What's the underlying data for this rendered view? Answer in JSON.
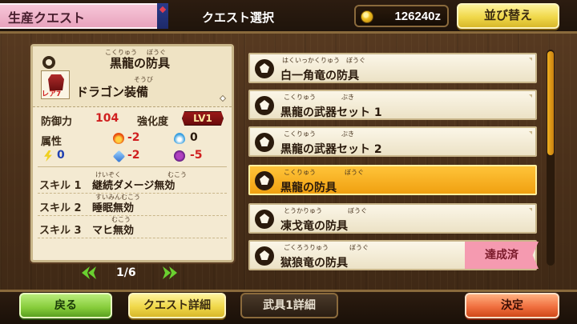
{
  "header": {
    "mode_tab": "生産クエスト",
    "screen_title": "クエスト選択",
    "money": "126240z",
    "sort_label": "並び替え"
  },
  "detail": {
    "name_ruby_1": "こくりゅう",
    "name_ruby_2": "ぼうぐ",
    "name": "黒龍の防具",
    "rarity": "レア7",
    "category_ruby": "そうび",
    "category": "ドラゴン装備",
    "defense_label": "防御力",
    "defense_value": "104",
    "enhance_label": "強化度",
    "level": "LV1",
    "attribute_label": "属性",
    "fire": "-2",
    "water": "0",
    "thunder": "0",
    "ice": "-2",
    "dragon": "-5",
    "skills": [
      {
        "slot": "スキル 1",
        "name": "継続ダメージ無効",
        "ruby_1": "けいぞく",
        "ruby_2": "むこう"
      },
      {
        "slot": "スキル 2",
        "name": "睡眠無効",
        "ruby_1": "すいみんむこう",
        "ruby_2": ""
      },
      {
        "slot": "スキル 3",
        "name": "マヒ無効",
        "ruby_1": "むこう",
        "ruby_2": ""
      }
    ]
  },
  "pager": {
    "text": "1/6"
  },
  "quests": [
    {
      "title": "白一角竜の防具",
      "ruby_1": "はくいっかくりゅう",
      "ruby_2": "ぼうぐ",
      "selected": false,
      "status": ""
    },
    {
      "title": "黒龍の武器セット 1",
      "ruby_1": "こくりゅう",
      "ruby_2": "ぶき",
      "selected": false,
      "status": ""
    },
    {
      "title": "黒龍の武器セット 2",
      "ruby_1": "こくりゅう",
      "ruby_2": "ぶき",
      "selected": false,
      "status": ""
    },
    {
      "title": "黒龍の防具",
      "ruby_1": "こくりゅう",
      "ruby_2": "ぼうぐ",
      "selected": true,
      "status": ""
    },
    {
      "title": "凍戈竜の防具",
      "ruby_1": "とうかりゅう",
      "ruby_2": "ぼうぐ",
      "selected": false,
      "status": ""
    },
    {
      "title": "獄狼竜の防具",
      "ruby_1": "ごくろうりゅう",
      "ruby_2": "ぼうぐ",
      "selected": false,
      "status": "達成済"
    }
  ],
  "footer": {
    "back": "戻る",
    "quest_detail": "クエスト詳細",
    "weapon_detail": "武具1詳細",
    "confirm": "決定"
  },
  "colors": {
    "selected": "#f0a010",
    "done_badge": "#f59ab0",
    "accent_green": "#86cc3a"
  }
}
